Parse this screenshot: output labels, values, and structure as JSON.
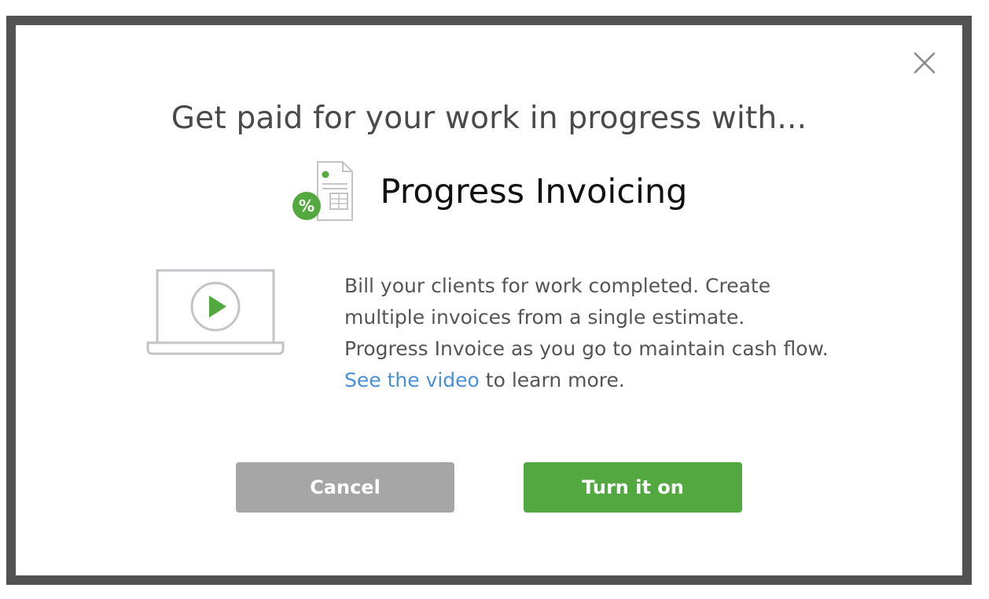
{
  "dialog": {
    "headline": "Get paid for your work in progress with...",
    "feature_title": "Progress Invoicing",
    "feature_icon": "percent-invoice-icon",
    "video_icon": "laptop-play-icon",
    "description": {
      "part1": "Bill your clients for work completed. Create multiple invoices from a single estimate. Progress Invoice as you go to maintain cash flow.",
      "link": "See the video",
      "part2": "to learn more."
    },
    "close_icon": "close-icon",
    "buttons": {
      "cancel": "Cancel",
      "confirm": "Turn it on"
    }
  },
  "colors": {
    "frame_border": "#525252",
    "headline_text": "#4a4a4a",
    "body_text": "#555555",
    "link": "#4a90d9",
    "cancel_button": "#a6a6a6",
    "confirm_button": "#53a93f",
    "icon_green": "#53a93f",
    "icon_gray": "#c4c4c8"
  }
}
